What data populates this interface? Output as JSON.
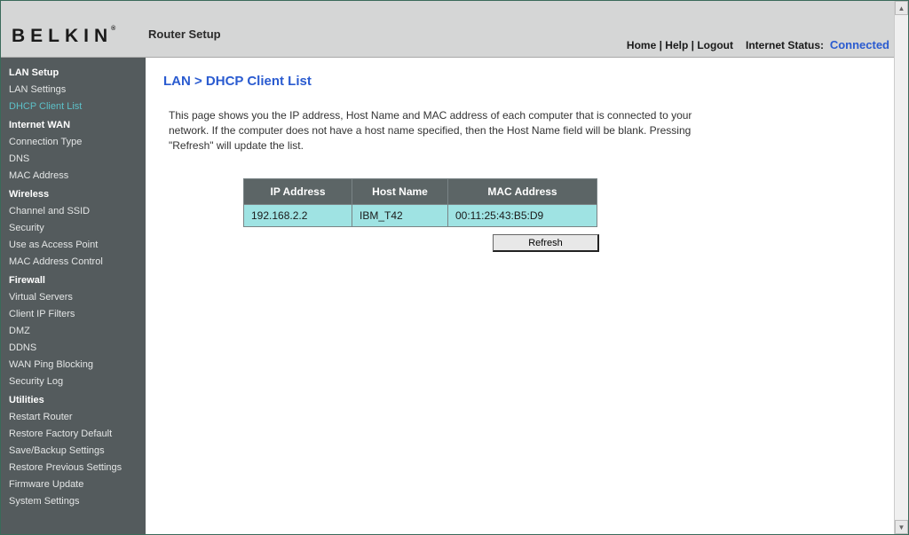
{
  "header": {
    "logo": "BELKIN",
    "app_title": "Router Setup",
    "links": {
      "home": "Home",
      "help": "Help",
      "logout": "Logout"
    },
    "status_label": "Internet Status:",
    "status_value": "Connected"
  },
  "sidebar": {
    "sections": [
      {
        "title": "LAN Setup",
        "items": [
          {
            "label": "LAN Settings",
            "active": false
          },
          {
            "label": "DHCP Client List",
            "active": true
          }
        ]
      },
      {
        "title": "Internet WAN",
        "items": [
          {
            "label": "Connection Type"
          },
          {
            "label": "DNS"
          },
          {
            "label": "MAC Address"
          }
        ]
      },
      {
        "title": "Wireless",
        "items": [
          {
            "label": "Channel and SSID"
          },
          {
            "label": "Security"
          },
          {
            "label": "Use as Access Point"
          },
          {
            "label": "MAC Address Control"
          }
        ]
      },
      {
        "title": "Firewall",
        "items": [
          {
            "label": "Virtual Servers"
          },
          {
            "label": "Client IP Filters"
          },
          {
            "label": "DMZ"
          },
          {
            "label": "DDNS"
          },
          {
            "label": "WAN Ping Blocking"
          },
          {
            "label": "Security Log"
          }
        ]
      },
      {
        "title": "Utilities",
        "items": [
          {
            "label": "Restart Router"
          },
          {
            "label": "Restore Factory Default"
          },
          {
            "label": "Save/Backup Settings"
          },
          {
            "label": "Restore Previous Settings"
          },
          {
            "label": "Firmware Update"
          },
          {
            "label": "System Settings"
          }
        ]
      }
    ]
  },
  "page": {
    "title": "LAN > DHCP Client List",
    "description": "This page shows you the IP address, Host Name and MAC address of each computer that is connected to your network. If the computer does not have a host name specified, then the Host Name field will be blank. Pressing \"Refresh\" will update the list.",
    "table": {
      "headers": {
        "ip": "IP Address",
        "host": "Host Name",
        "mac": "MAC Address"
      },
      "rows": [
        {
          "ip": "192.168.2.2",
          "host": "IBM_T42",
          "mac": "00:11:25:43:B5:D9"
        }
      ]
    },
    "refresh_label": "Refresh"
  }
}
